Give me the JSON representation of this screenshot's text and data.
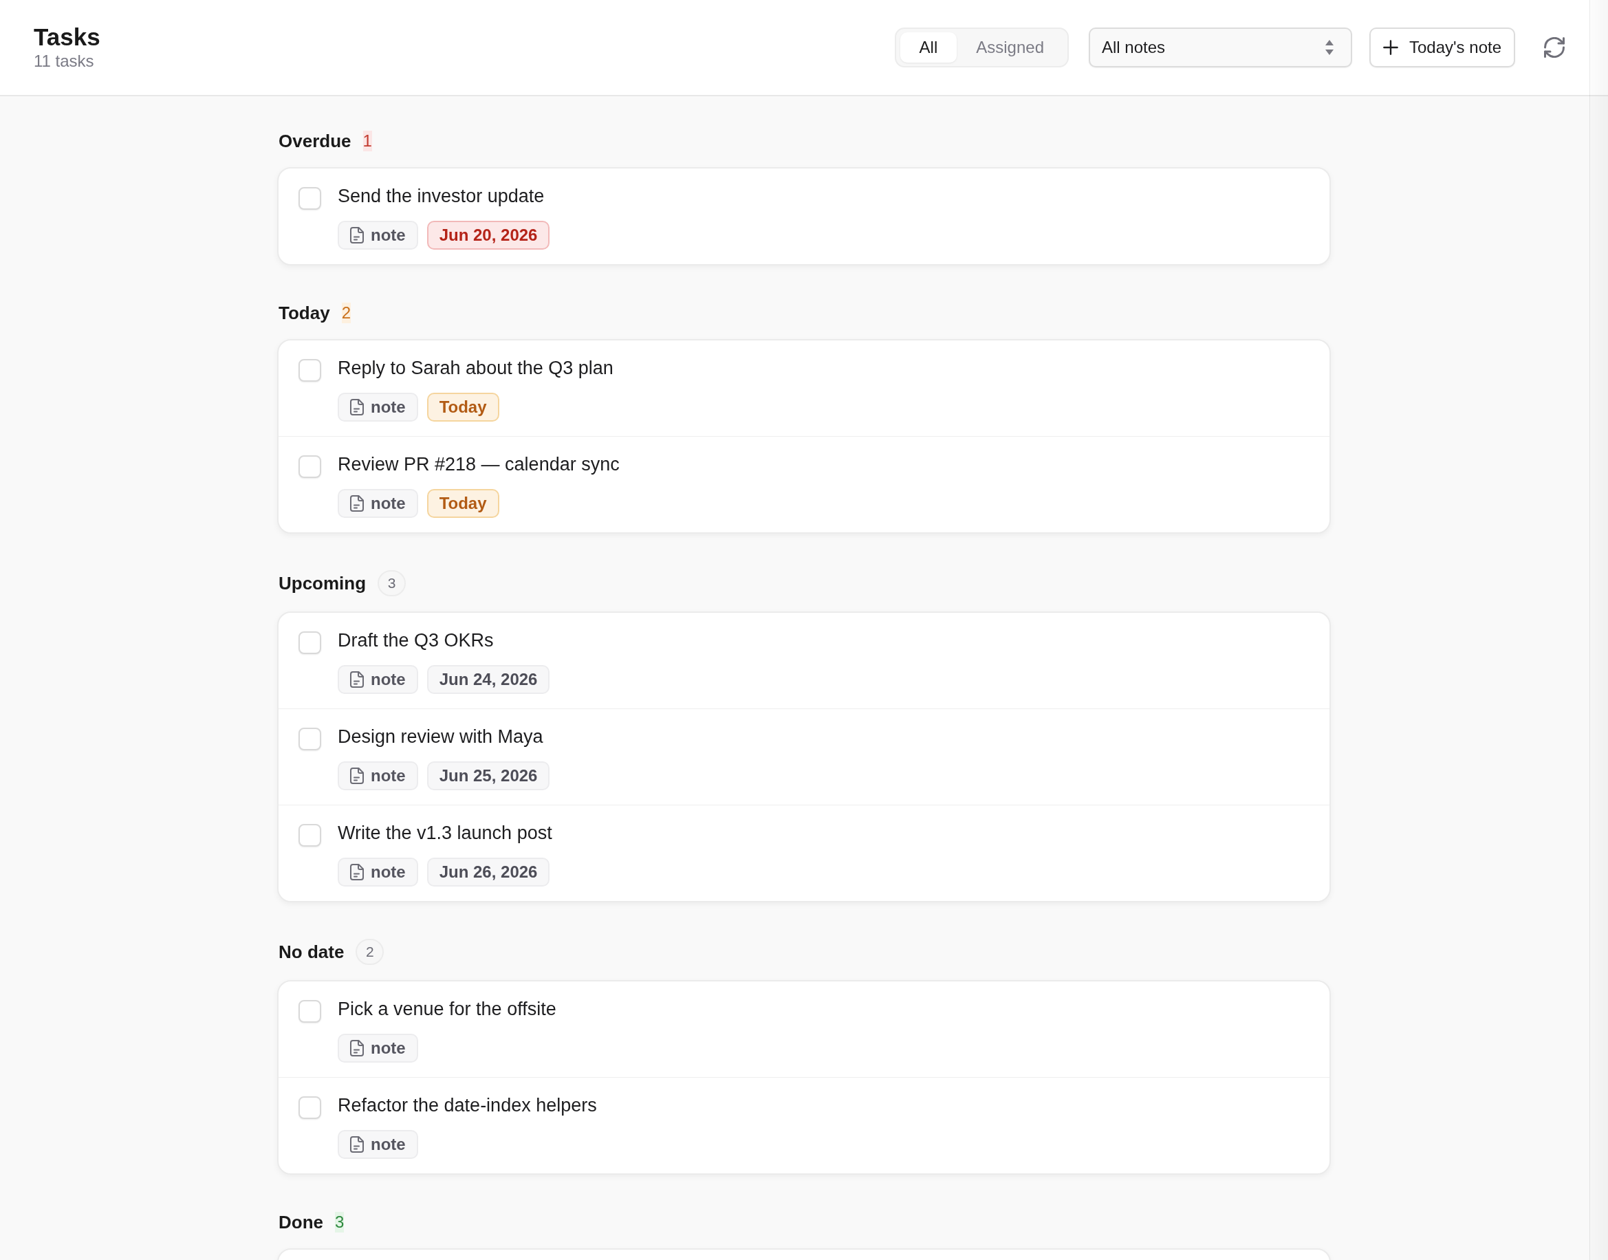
{
  "header": {
    "title": "Tasks",
    "subtitle": "11 tasks",
    "filter_tabs": [
      {
        "label": "All",
        "selected": true
      },
      {
        "label": "Assigned",
        "selected": false
      }
    ],
    "notes_select": {
      "value": "All notes"
    },
    "new_note_button": {
      "label": "Today's note"
    }
  },
  "sections": [
    {
      "kind": "overdue",
      "title": "Overdue",
      "count": "1",
      "tasks": [
        {
          "title": "Send the investor update",
          "checked": false,
          "note": "note",
          "due": "Jun 20, 2026"
        }
      ]
    },
    {
      "kind": "today",
      "title": "Today",
      "count": "2",
      "tasks": [
        {
          "title": "Reply to Sarah about the Q3 plan",
          "checked": false,
          "note": "note",
          "due": "Today"
        },
        {
          "title": "Review PR #218 — calendar sync",
          "checked": false,
          "note": "note",
          "due": "Today"
        }
      ]
    },
    {
      "kind": "upcoming",
      "title": "Upcoming",
      "count": "3",
      "tasks": [
        {
          "title": "Draft the Q3 OKRs",
          "checked": false,
          "note": "note",
          "due": "Jun 24, 2026"
        },
        {
          "title": "Design review with Maya",
          "checked": false,
          "note": "note",
          "due": "Jun 25, 2026"
        },
        {
          "title": "Write the v1.3 launch post",
          "checked": false,
          "note": "note",
          "due": "Jun 26, 2026"
        }
      ]
    },
    {
      "kind": "no_date",
      "title": "No date",
      "count": "2",
      "tasks": [
        {
          "title": "Pick a venue for the offsite",
          "checked": false,
          "note": "note"
        },
        {
          "title": "Refactor the date-index helpers",
          "checked": false,
          "note": "note"
        }
      ]
    },
    {
      "kind": "done",
      "title": "Done",
      "count": "3"
    }
  ]
}
